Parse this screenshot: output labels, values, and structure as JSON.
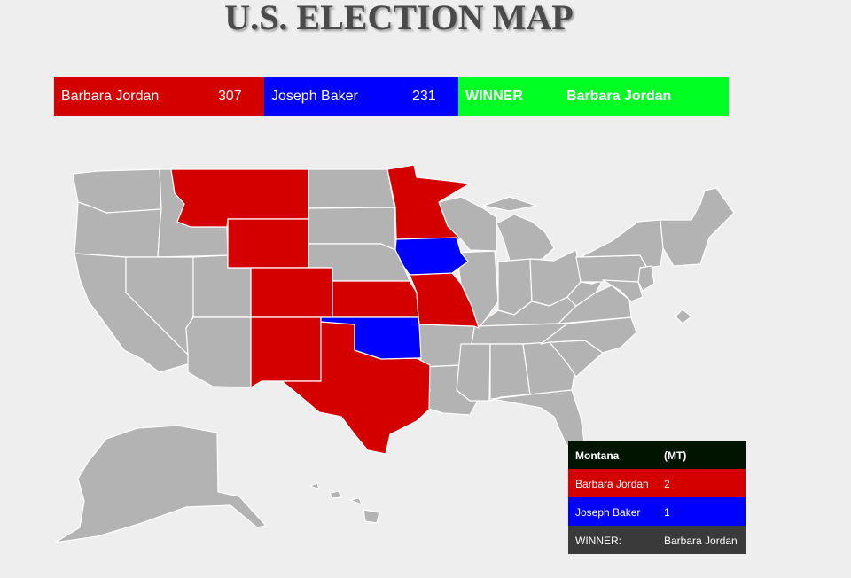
{
  "title": "U.S. ELECTION MAP",
  "colors": {
    "candidate_a": "#d40000",
    "candidate_b": "#0000ff",
    "winner": "#00ff22",
    "undecided": "#b3b3b3",
    "background": "#eeeeee"
  },
  "scoreboard": {
    "candidate_a": {
      "name": "Barbara Jordan",
      "votes": "307"
    },
    "candidate_b": {
      "name": "Joseph Baker",
      "votes": "231"
    },
    "winner_label": "WINNER",
    "winner_name": "Barbara Jordan"
  },
  "map": {
    "states_a": [
      "Montana",
      "Wyoming",
      "Colorado",
      "New Mexico",
      "Texas",
      "Kansas",
      "Minnesota",
      "Missouri"
    ],
    "states_b": [
      "Iowa",
      "Oklahoma"
    ]
  },
  "tooltip": {
    "state": "Montana",
    "abbr": "(MT)",
    "candidate_a": {
      "name": "Barbara Jordan",
      "votes": "2"
    },
    "candidate_b": {
      "name": "Joseph Baker",
      "votes": "1"
    },
    "winner_label": "WINNER:",
    "winner_name": "Barbara Jordan"
  }
}
